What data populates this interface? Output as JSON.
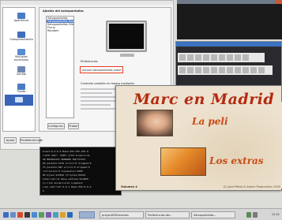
{
  "sidebar": {
    "items": [
      {
        "label": "Apariencia",
        "icon": "display-icon"
      },
      {
        "label": "Comportamiento",
        "icon": "gear-icon"
      },
      {
        "label": "Multiples escritorios",
        "icon": "desktops-icon"
      },
      {
        "label": "Sonido",
        "icon": "speaker-icon"
      },
      {
        "label": "Fondo",
        "icon": "image-icon"
      },
      {
        "label": "",
        "icon": "monitor-icon"
      }
    ]
  },
  "dialog": {
    "title": "Ajustes del salvapantallas",
    "list": [
      "Salvapantallas",
      "Salvapantallas Blank",
      "Salvapantallas Slide Show",
      "Flurry",
      "Random"
    ],
    "highlight_text": "Activar salvapantallas automáticamente",
    "options": [
      "Preferencias",
      "Activar salvapantallas automáticamente",
      "Controlar pantalla en reposo mediante"
    ],
    "button_configure": "Configurar...",
    "button_test": "Probar",
    "button_help": "Ayuda",
    "button_defaults": "Predeterminado"
  },
  "terminal": {
    "lines": [
      "bcast:0.0.0.0 Mask:255.255.255.0",
      "inet6 addr: fe80::1/64 Scope:Link",
      "UP BROADCAST RUNNING MULTICAST",
      "RX packets:1234 errors:0 dropped:0",
      "TX packets:987 errors:0 dropped:0",
      "collisions:0 txqueuelen:1000",
      "RX bytes:123456 TX bytes:65432",
      "Interrupt:11 Base address:0xd000",
      "lo Link encap:Local Loopback",
      "inet addr:127.0.0.1 Mask:255.0.0.0",
      "$"
    ]
  },
  "dvd": {
    "title": "Marc en Madrid",
    "menu_1": "La peli",
    "menu_2": "Los extras",
    "footer_left": "Volumen 4",
    "footer_right": "(C) Jordi Pérez & Admin Productions 2005"
  },
  "taskbar": {
    "tasks": [
      "proyectDVDmarkes",
      "Preferencias del...",
      "Salvapantallas..."
    ],
    "clock": "12:41"
  },
  "colors": {
    "highlight": "#e23a1e",
    "dvd_title": "#b32b12",
    "dvd_menu": "#c84a16",
    "dvd_bg": "#ede2cf"
  }
}
